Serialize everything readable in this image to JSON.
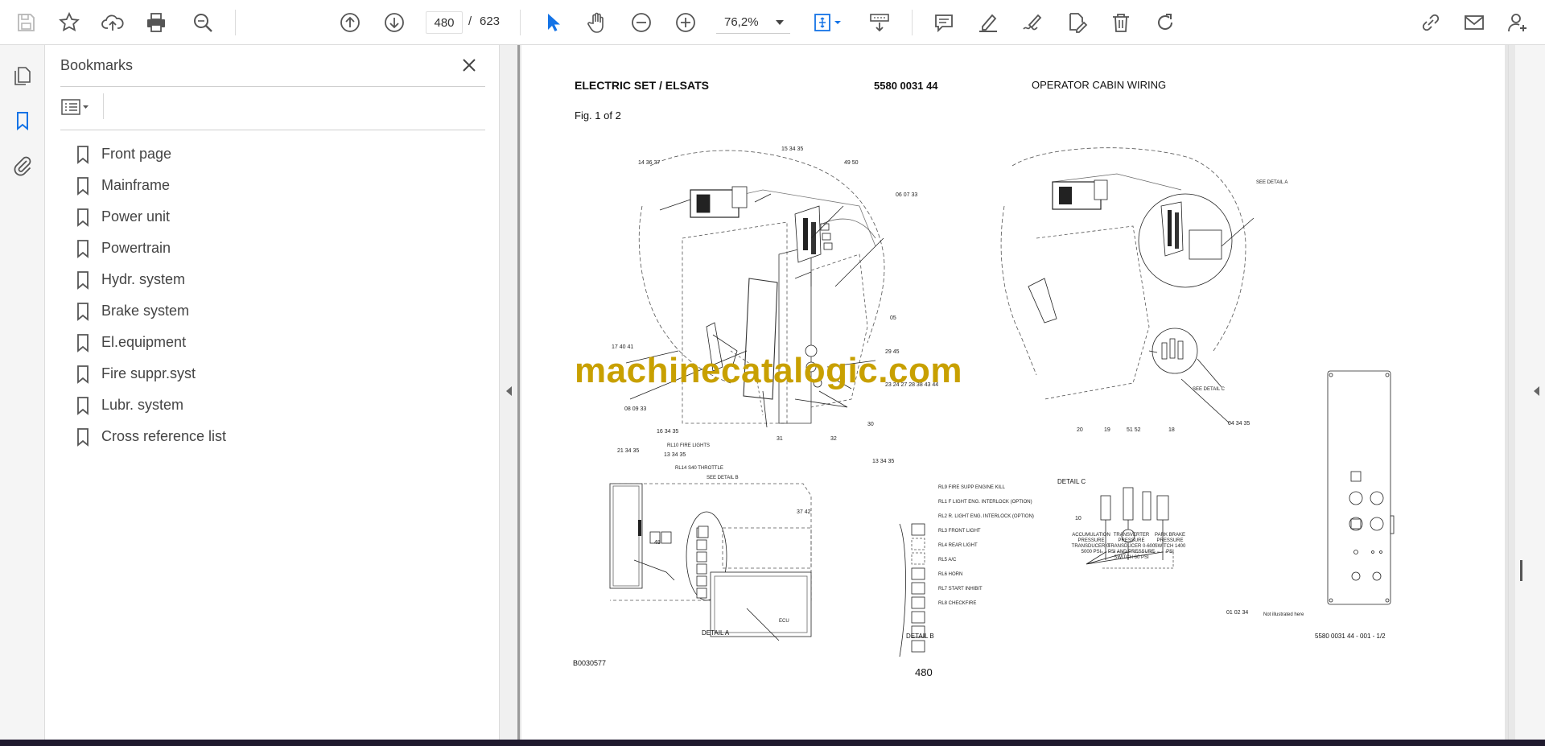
{
  "toolbar": {
    "page_current": "480",
    "page_sep": "/",
    "page_total": "623",
    "zoom": "76,2%"
  },
  "bookmarks": {
    "title": "Bookmarks",
    "items": [
      {
        "label": "Front page"
      },
      {
        "label": "Mainframe"
      },
      {
        "label": "Power unit"
      },
      {
        "label": "Powertrain"
      },
      {
        "label": "Hydr. system"
      },
      {
        "label": "Brake system"
      },
      {
        "label": "El.equipment"
      },
      {
        "label": "Fire suppr.syst"
      },
      {
        "label": "Lubr. system"
      },
      {
        "label": "Cross reference list"
      }
    ]
  },
  "document": {
    "header_left": "ELECTRIC SET / ELSATS",
    "header_code": "5580 0031 44",
    "header_right": "OPERATOR CABIN WIRING",
    "fig_label": "Fig. 1 of 2",
    "watermark": "machinecatalogic.com",
    "drawing_no": "B0030577",
    "page_number": "480",
    "ref_code": "5580 0031 44 - 001 - 1/2",
    "detail_a": "DETAIL A",
    "detail_b": "DETAIL B",
    "detail_c": "DETAIL C",
    "see_detail_a": "SEE DETAIL A",
    "see_detail_b": "SEE DETAIL B",
    "see_detail_c": "SEE DETAIL C",
    "not_illustrated": "Not illustrated here",
    "ecu": "ECU",
    "callouts": [
      "14 36 37",
      "15 34 35",
      "49 50",
      "06 07 33",
      "05",
      "29 45",
      "23 24 27 28 38 43 44",
      "30",
      "32",
      "31",
      "17 40 41",
      "08 09 33",
      "16 34 35",
      "21 34 35",
      "13 34 35",
      "48",
      "37 42",
      "13 34 35",
      "20",
      "19",
      "51 52",
      "18",
      "10",
      "04 34 35",
      "01 02 34"
    ],
    "relay_labels_a": [
      "RL10 FIRE LIGHTS",
      "RL14 S40 THROTTLE"
    ],
    "relay_labels_b": [
      "RL9 FIRE SUPP ENGINE KILL",
      "RL1 F LIGHT ENG. INTERLOCK (OPTION)",
      "RL2 R. LIGHT ENG. INTERLOCK (OPTION)",
      "RL3 FRONT LIGHT",
      "RL4 REAR LIGHT",
      "RL5 A/C",
      "RL6 HORN",
      "RL7 START INHIBIT",
      "RL8 CHECKFIRE"
    ],
    "sensor_labels": [
      "ACCUMULATION PRESSURE TRANSDUCER 0-5000 PSI",
      "TRANSVERTER PRESSURE TRANSDUCER 0-600 PSI AND PRESSURE SWITCH 60 PSI",
      "PARK BRAKE PRESSURE SWITCH 1400 PSI"
    ]
  }
}
